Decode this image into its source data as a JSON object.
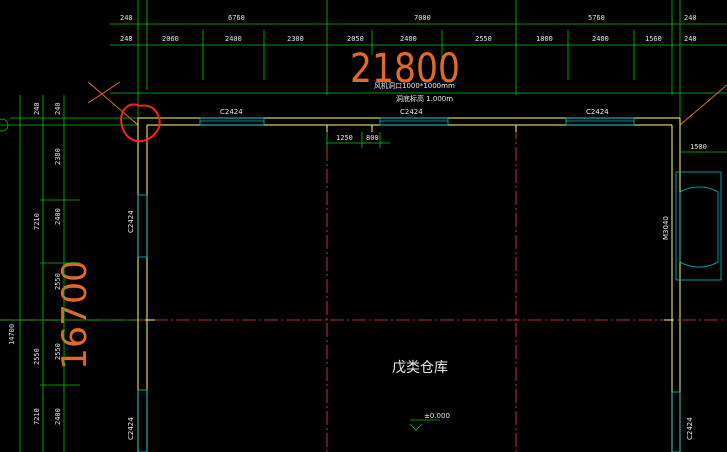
{
  "drawing": {
    "overall_width": "21800",
    "overall_height": "16700",
    "room_label": "戊类仓库",
    "elevation": "±0.000",
    "note_duct": "风机洞口1000*1000mm",
    "note_top": "洞底标高 1.000m",
    "window_tag": "C2424",
    "door_tag": "M3040",
    "left_outer_dim": "14700"
  },
  "top_dims_row1": [
    "240",
    "6760",
    "7000",
    "5760",
    "240"
  ],
  "top_dims_row2": [
    "240",
    "2060",
    "2400",
    "2300",
    "2050",
    "2400",
    "2550",
    "1800",
    "2400",
    "1560",
    "240"
  ],
  "left_dims_outer": [
    "240",
    "7210",
    "2550",
    "7210"
  ],
  "left_dims_inner": [
    "240",
    "2380",
    "2400",
    "2550",
    "2550",
    "2400"
  ],
  "small_dims": [
    "1250",
    "800",
    "1500"
  ],
  "colors": {
    "background": "#000000",
    "dim_green": "#00c800",
    "wall_yellow": "#ffff66",
    "axis_red": "#ff3b3b",
    "window_cyan": "#00c0d8",
    "big_text_orange": "#e06a2a",
    "markup_red": "#ff2020"
  }
}
